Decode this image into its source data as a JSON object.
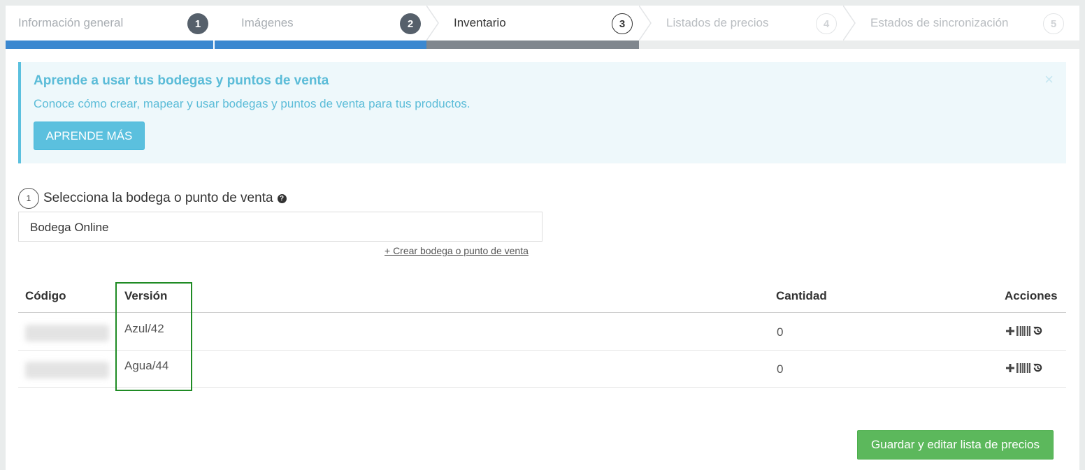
{
  "wizard": {
    "steps": [
      {
        "label": "Información general",
        "number": "1",
        "state": "done"
      },
      {
        "label": "Imágenes",
        "number": "2",
        "state": "done"
      },
      {
        "label": "Inventario",
        "number": "3",
        "state": "current"
      },
      {
        "label": "Listados de precios",
        "number": "4",
        "state": "future"
      },
      {
        "label": "Estados de sincronización",
        "number": "5",
        "state": "future"
      }
    ],
    "colors": {
      "done_bar": "#3b88d0",
      "current_bar": "#80878e",
      "future_bar": "#ebeded"
    }
  },
  "alert": {
    "title": "Aprende a usar tus bodegas y puntos de venta",
    "description": "Conoce cómo crear, mapear y usar bodegas y puntos de venta para tus productos.",
    "button_label": "APRENDE MÁS",
    "close_symbol": "×",
    "accent_color": "#5bc0de"
  },
  "warehouse": {
    "step_number": "1",
    "label": "Selecciona la bodega o punto de venta",
    "help_symbol": "?",
    "selected": "Bodega Online",
    "create_link": "+ Crear bodega o punto de venta"
  },
  "table": {
    "headers": {
      "code": "Código",
      "version": "Versión",
      "quantity": "Cantidad",
      "actions": "Acciones"
    },
    "rows": [
      {
        "version": "Azul/42",
        "quantity": "0"
      },
      {
        "version": "Agua/44",
        "quantity": "0"
      }
    ],
    "action_icons": [
      "plus-icon",
      "barcode-icon",
      "history-icon"
    ]
  },
  "save_button": {
    "label": "Guardar y editar lista de precios",
    "color": "#5cb85c"
  },
  "highlight_color": "#1f8b24"
}
